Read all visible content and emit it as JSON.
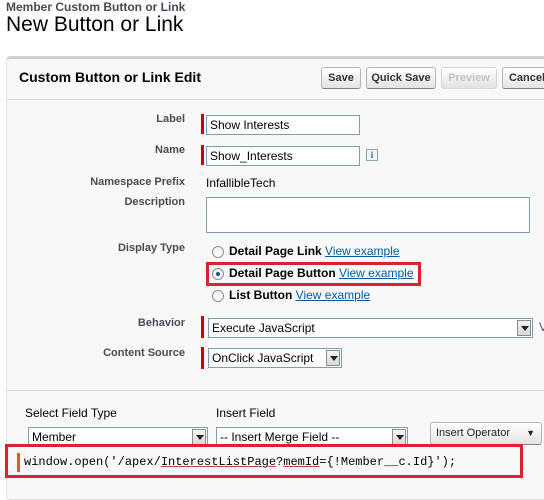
{
  "header": {
    "breadcrumb": "Member Custom Button or Link",
    "title": "New Button or Link"
  },
  "panel": {
    "title": "Custom Button or Link Edit",
    "buttons": {
      "save": "Save",
      "quick_save": "Quick Save",
      "preview": "Preview",
      "cancel": "Cancel"
    }
  },
  "form": {
    "label": {
      "label": "Label",
      "value": "Show Interests"
    },
    "name": {
      "label": "Name",
      "value": "Show_Interests",
      "info": "i"
    },
    "namespace": {
      "label": "Namespace Prefix",
      "value": "InfallibleTech"
    },
    "description": {
      "label": "Description",
      "value": ""
    },
    "display_type": {
      "label": "Display Type",
      "options": [
        {
          "label": "Detail Page Link",
          "link": "View example",
          "selected": false
        },
        {
          "label": "Detail Page Button",
          "link": "View example",
          "selected": true
        },
        {
          "label": "List Button",
          "link": "View example",
          "selected": false
        }
      ]
    },
    "behavior": {
      "label": "Behavior",
      "value": "Execute JavaScript"
    },
    "content_source": {
      "label": "Content Source",
      "value": "OnClick JavaScript"
    }
  },
  "editor_toolbar": {
    "select_field_type_label": "Select Field Type",
    "select_field_type_value": "Member",
    "insert_field_label": "Insert Field",
    "insert_field_value": "-- Insert Merge Field --",
    "insert_operator": "Insert Operator"
  },
  "code": {
    "part1": "window.open('/apex/",
    "part2": "InterestListPage",
    "part3": "?",
    "part4": "memId",
    "part5": "={!Member__c.Id}');"
  },
  "colors": {
    "required": "#cc0000",
    "highlight": "#e0202a",
    "link": "#015ba7"
  }
}
